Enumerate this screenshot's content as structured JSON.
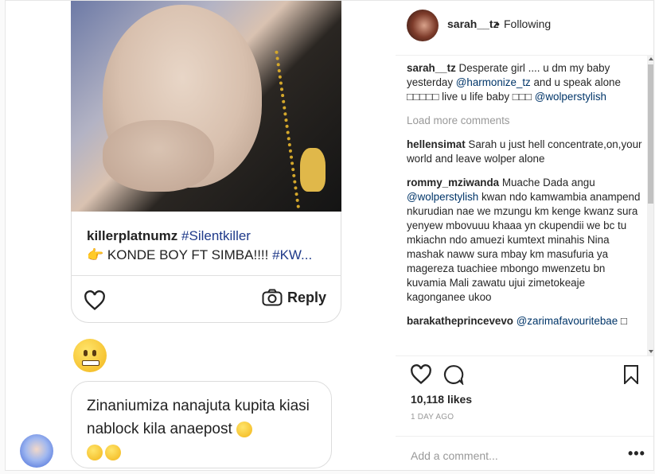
{
  "post_image": {
    "caption_user": "killerplatnumz",
    "caption_tag": "#Silentkiller",
    "caption_line2": "KONDE BOY FT SIMBA!!!! ",
    "caption_tag2": "#KW...",
    "reply_label": "Reply",
    "bubble_text": "Zinaniumiza nanajuta kupita kiasi nablock kila anaepost"
  },
  "header": {
    "username": "sarah__tz",
    "separator": "•",
    "follow_status": "Following"
  },
  "comments": {
    "caption": {
      "user": "sarah__tz",
      "text1": " Desperate girl .... u dm my baby yesterday ",
      "mention1": "@harmonize_tz",
      "text2": " and u speak alone □□□□□ live u life baby □□□ ",
      "mention2": "@wolperstylish"
    },
    "load_more": "Load more comments",
    "items": [
      {
        "user": "hellensimat",
        "pre": " Sarah u just hell concentrate,on,your world and leave wolper alone",
        "mention": "",
        "post": ""
      },
      {
        "user": "rommy_mziwanda",
        "pre": " Muache Dada angu ",
        "mention": "@wolperstylish",
        "post": " kwan ndo kamwambia anampend nkurudian nae we mzungu km kenge kwanz sura yenyew mbovuuu khaaa yn ckupendii we bc tu mkiachn ndo amuezi kumtext minahis Nina mashak naww sura mbay km masufuria ya magereza tuachiee mbongo mwenzetu bn kuvamia Mali zawatu ujui zimetokeaje kagonganee ukoo"
      },
      {
        "user": "barakatheprincevevo",
        "pre": " ",
        "mention": "@zarimafavouritebae",
        "post": " □"
      }
    ]
  },
  "actions": {
    "likes": "10,118 likes",
    "date": "1 DAY AGO",
    "add_comment_placeholder": "Add a comment...",
    "more_label": "•••"
  }
}
